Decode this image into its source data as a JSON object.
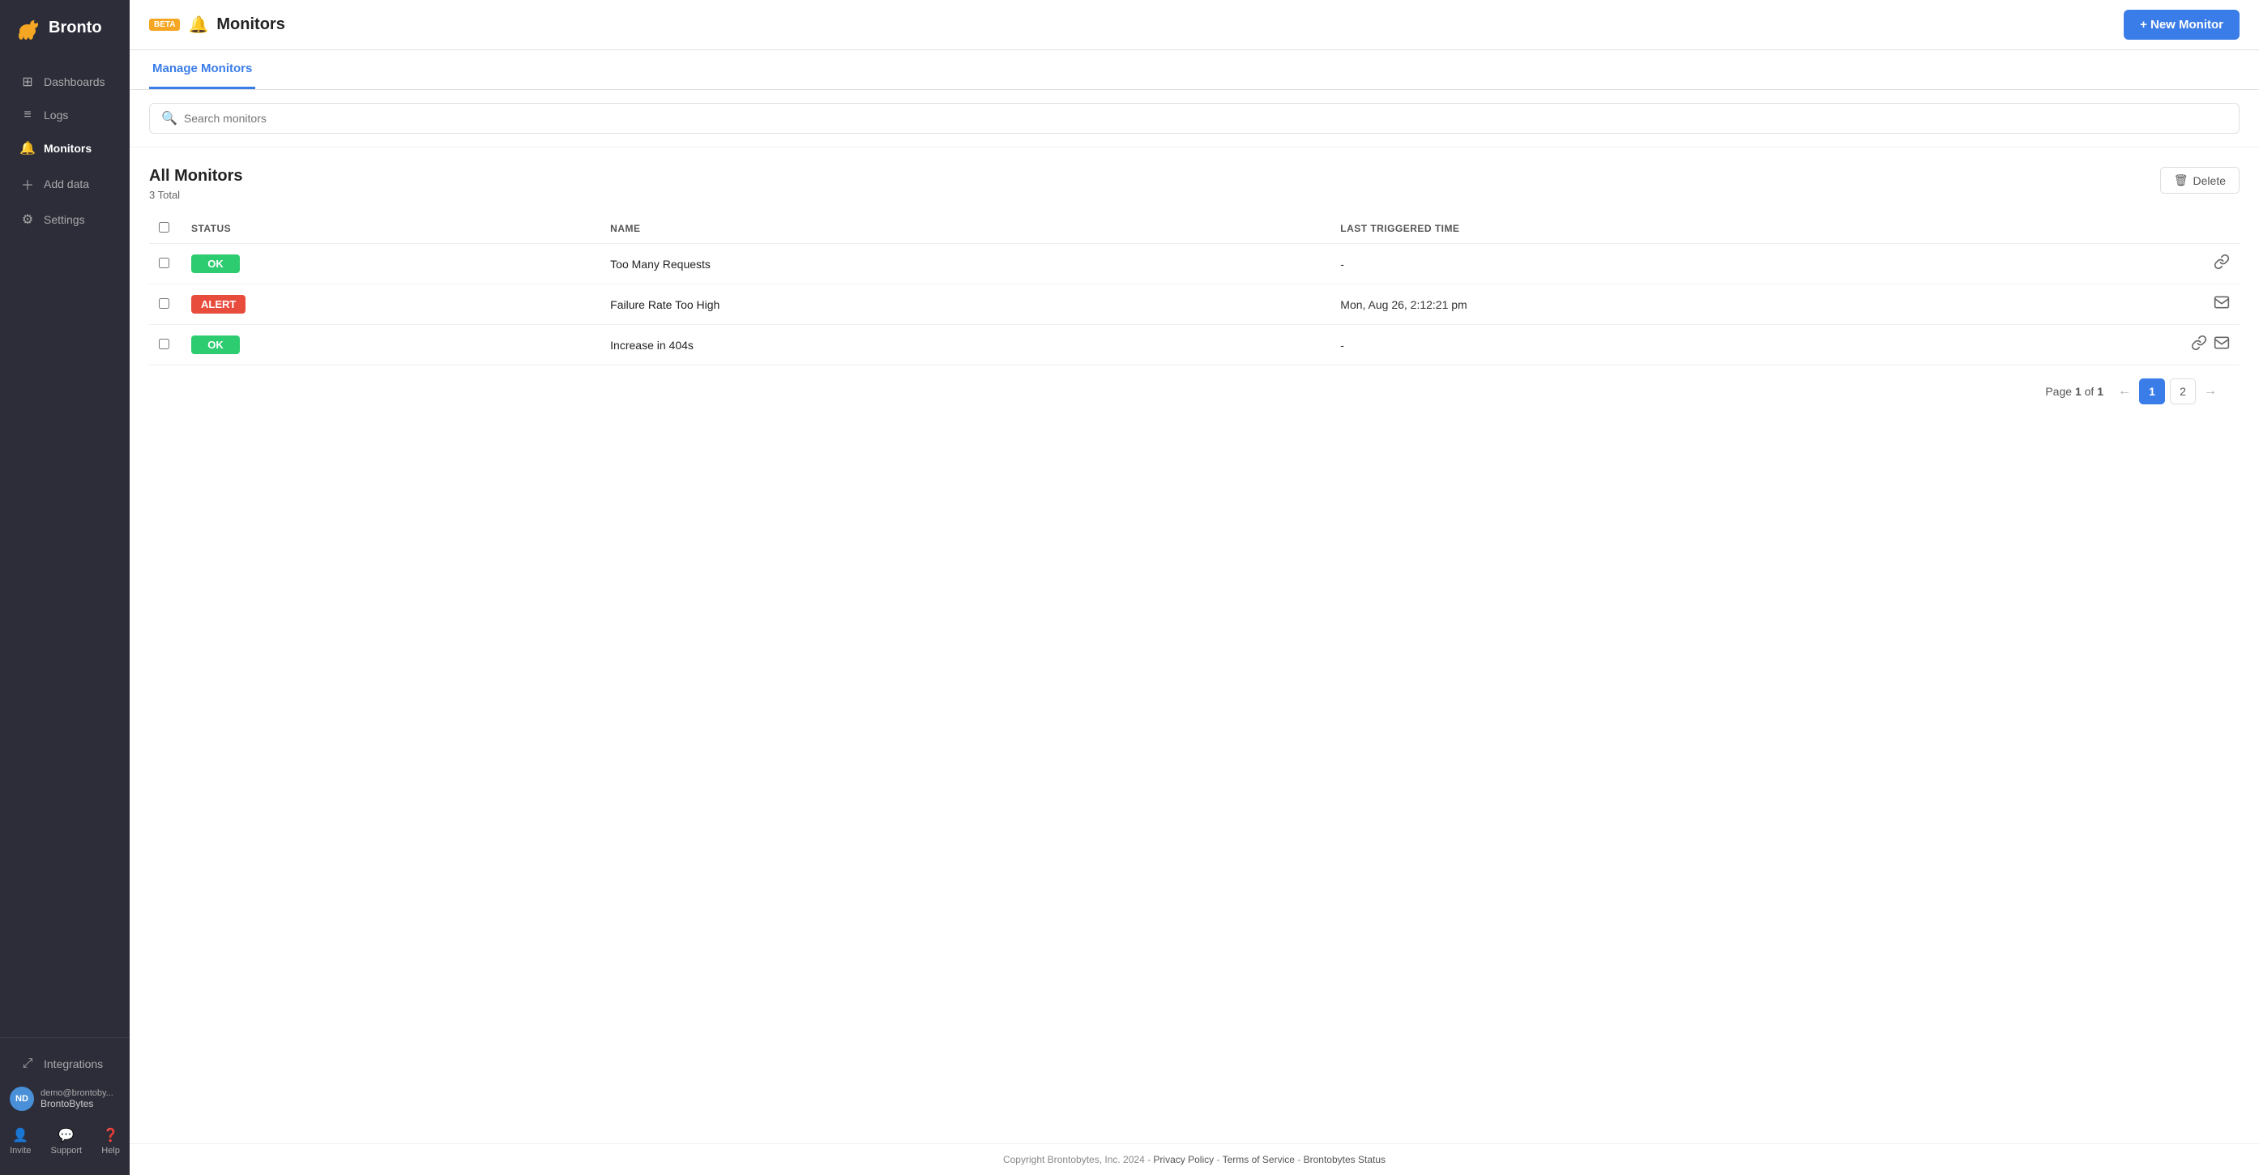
{
  "sidebar": {
    "logo_text": "Bronto",
    "nav_items": [
      {
        "id": "dashboards",
        "label": "Dashboards",
        "icon": "⊞",
        "active": false
      },
      {
        "id": "logs",
        "label": "Logs",
        "icon": "☰",
        "active": false
      },
      {
        "id": "monitors",
        "label": "Monitors",
        "icon": "🔔",
        "active": true
      },
      {
        "id": "add-data",
        "label": "Add data",
        "icon": "＋",
        "active": false
      },
      {
        "id": "settings",
        "label": "Settings",
        "icon": "⚙",
        "active": false
      }
    ],
    "bottom_nav": [
      {
        "id": "integrations",
        "label": "Integrations",
        "icon": "🔗"
      }
    ],
    "user": {
      "initials": "ND",
      "email": "demo@brontoby...",
      "org": "BrontoBytes"
    },
    "actions": [
      {
        "id": "invite",
        "label": "Invite",
        "icon": "👤"
      },
      {
        "id": "support",
        "label": "Support",
        "icon": "💬"
      },
      {
        "id": "help",
        "label": "Help",
        "icon": "❓"
      }
    ]
  },
  "header": {
    "beta_label": "BETA",
    "bell_icon": "🔔",
    "title": "Monitors",
    "new_monitor_label": "+ New Monitor"
  },
  "tabs": [
    {
      "id": "manage",
      "label": "Manage Monitors",
      "active": true
    }
  ],
  "search": {
    "placeholder": "Search monitors"
  },
  "table": {
    "section_title": "All Monitors",
    "total_label": "3 Total",
    "delete_button": "Delete",
    "columns": [
      {
        "id": "checkbox",
        "label": ""
      },
      {
        "id": "status",
        "label": "STATUS"
      },
      {
        "id": "name",
        "label": "NAME"
      },
      {
        "id": "last_triggered",
        "label": "LAST TRIGGERED TIME"
      },
      {
        "id": "actions",
        "label": ""
      }
    ],
    "rows": [
      {
        "id": 1,
        "status": "OK",
        "status_type": "ok",
        "name": "Too Many Requests",
        "last_triggered": "-",
        "actions": [
          "webhook"
        ]
      },
      {
        "id": 2,
        "status": "ALERT",
        "status_type": "alert",
        "name": "Failure Rate Too High",
        "last_triggered": "Mon, Aug 26, 2:12:21 pm",
        "actions": [
          "email"
        ]
      },
      {
        "id": 3,
        "status": "OK",
        "status_type": "ok",
        "name": "Increase in 404s",
        "last_triggered": "-",
        "actions": [
          "webhook",
          "email"
        ]
      }
    ]
  },
  "pagination": {
    "page_label": "Page",
    "current_page": 1,
    "total_pages": 1,
    "page_of_label": "of",
    "pages": [
      1,
      2
    ]
  },
  "footer": {
    "copyright": "Copyright Brontobytes, Inc. 2024 -",
    "links": [
      {
        "id": "privacy",
        "label": "Privacy Policy"
      },
      {
        "id": "terms",
        "label": "Terms of Service"
      },
      {
        "id": "status",
        "label": "Brontobytes Status"
      }
    ],
    "separator": "-"
  }
}
